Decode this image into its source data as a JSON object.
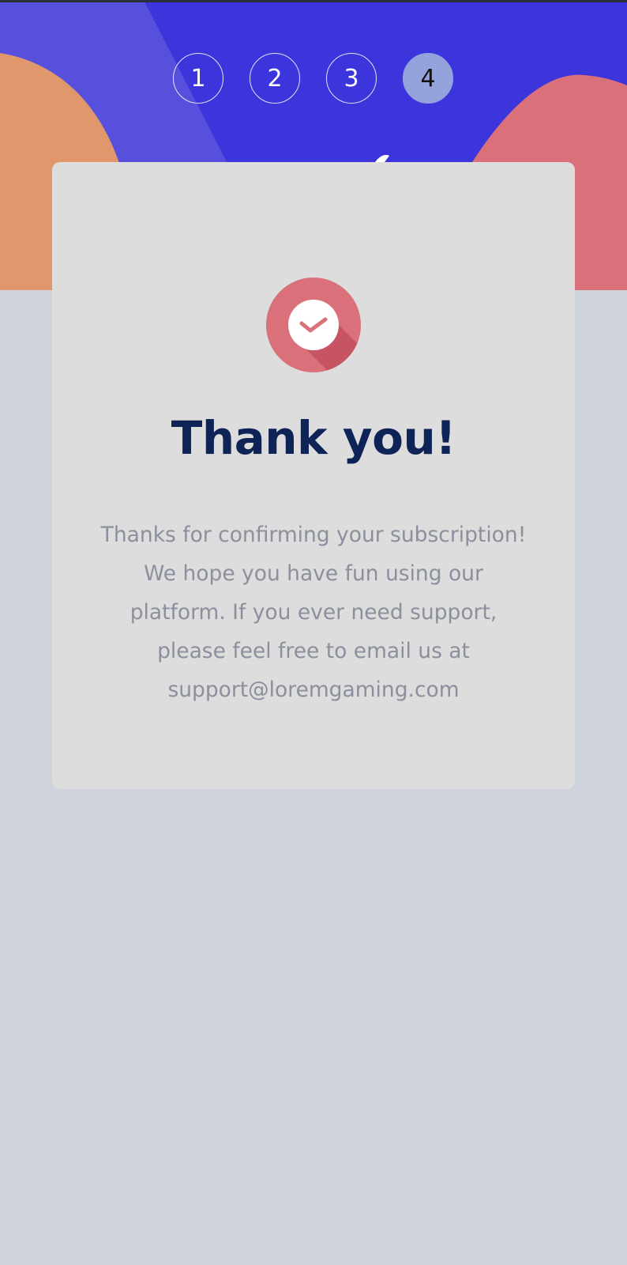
{
  "steps": [
    {
      "label": "1",
      "active": false
    },
    {
      "label": "2",
      "active": false
    },
    {
      "label": "3",
      "active": false
    },
    {
      "label": "4",
      "active": true
    }
  ],
  "confirmation": {
    "icon": "checkmark-icon",
    "title": "Thank you!",
    "message_lines": [
      "Thanks for confirming your subscription!",
      "We hope you have fun using our",
      "platform. If you ever need support,",
      "please feel free to email us at",
      "support@loremgaming.com"
    ]
  },
  "colors": {
    "header_bg": "#3d35dc",
    "page_bg": "#cfd3dc",
    "card_bg": "#dddddd",
    "accent": "#d9707a",
    "orange_blob": "#e0976c",
    "title": "#0e2457",
    "body_text": "#8b8f9e",
    "active_step": "#95a3dc"
  }
}
